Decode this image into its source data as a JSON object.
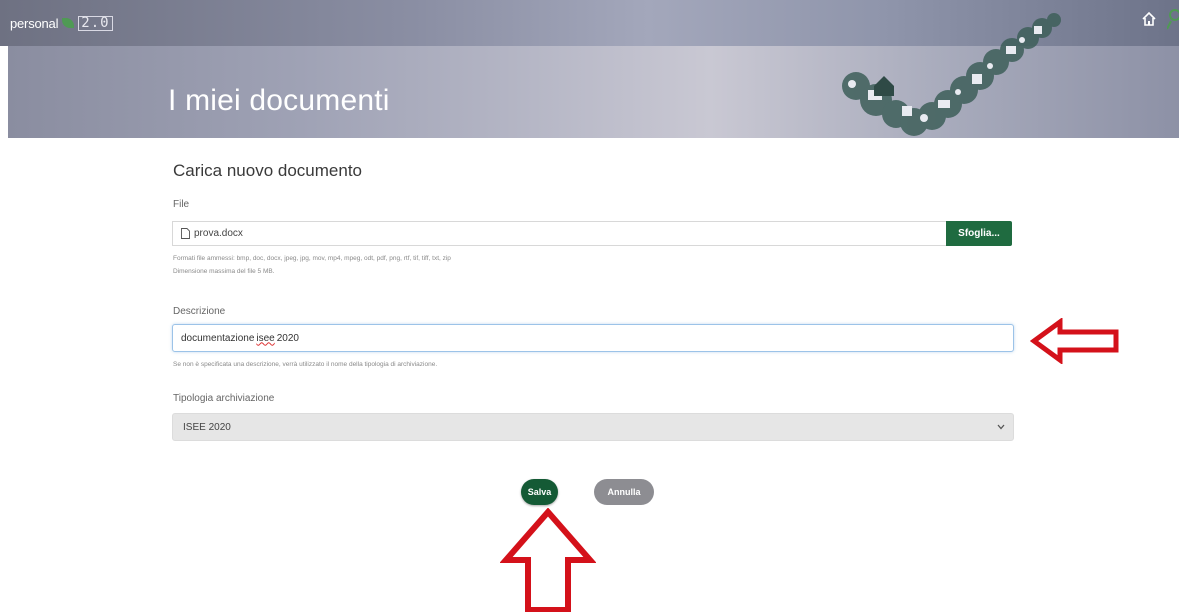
{
  "header": {
    "brand_name": "personal",
    "brand_version": "2.0",
    "brand_color": "#4f9a54"
  },
  "hero": {
    "title": "I miei documenti"
  },
  "form": {
    "title": "Carica nuovo documento",
    "file": {
      "label": "File",
      "value": "prova.docx",
      "browse_label": "Sfoglia...",
      "help_formats": "Formati file ammessi: bmp, doc, docx, jpeg, jpg, mov, mp4, mpeg, odt, pdf, png, rtf, tif, tiff, txt, zip",
      "help_size": "Dimensione massima del file 5 MB."
    },
    "description": {
      "label": "Descrizione",
      "value_before": "documentazione",
      "value_misspelled": "isee",
      "value_after": "2020",
      "help": "Se non è specificata una descrizione, verrà utilizzato il nome della tipologia di archiviazione."
    },
    "archive_type": {
      "label": "Tipologia archiviazione",
      "selected": "ISEE 2020"
    },
    "save_label": "Salva",
    "cancel_label": "Annulla"
  },
  "colors": {
    "primary_green": "#1f6b40",
    "annotation_red": "#d4111a"
  }
}
